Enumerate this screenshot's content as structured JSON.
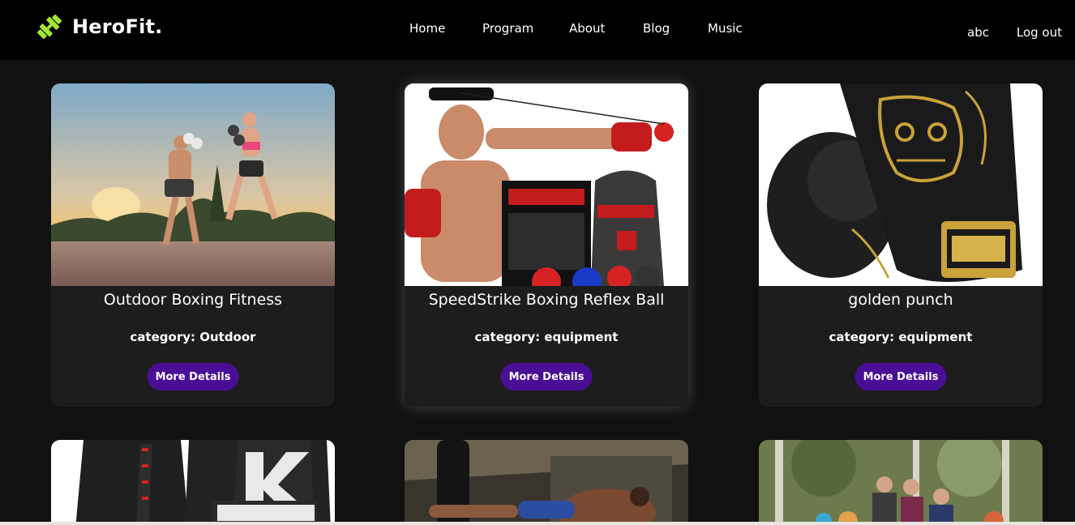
{
  "brand": {
    "name": "HeroFit.",
    "accent": "#a3e635"
  },
  "nav": {
    "items": [
      "Home",
      "Program",
      "About",
      "Blog",
      "Music"
    ]
  },
  "user": {
    "name": "abc",
    "logout_label": "Log out"
  },
  "cards": [
    {
      "title": "Outdoor Boxing Fitness",
      "category": "category: Outdoor",
      "button": "More Details"
    },
    {
      "title": "SpeedStrike Boxing Reflex Ball",
      "category": "category: equipment",
      "button": "More Details"
    },
    {
      "title": "golden punch",
      "category": "category: equipment",
      "button": "More Details"
    }
  ],
  "colors": {
    "button": "#4a0e96",
    "card": "#1d1d1e",
    "background": "#111111",
    "header": "#000000"
  }
}
